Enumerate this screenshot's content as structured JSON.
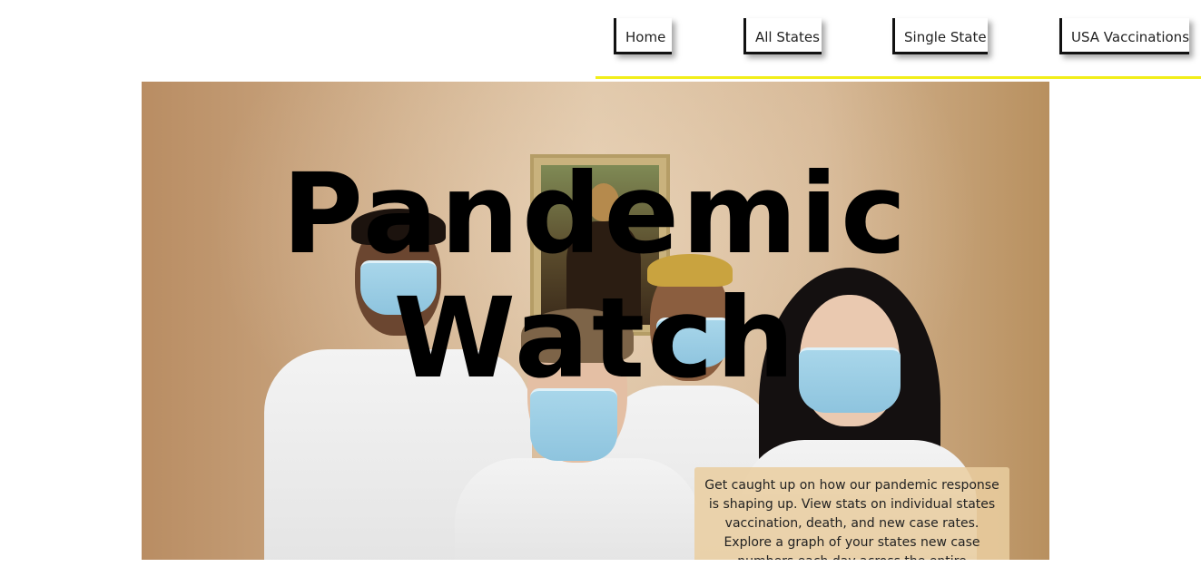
{
  "nav": {
    "items": [
      {
        "label": "Home"
      },
      {
        "label": "All States"
      },
      {
        "label": "Single State"
      },
      {
        "label": "USA Vaccinations"
      }
    ],
    "underline_color": "#f2ee1a"
  },
  "hero": {
    "title_line1": "Pandemic",
    "title_line2": "Watch",
    "description": "Get caught up on how our pandemic response is shaping up. View stats on individual states vaccination, death, and new case rates. Explore a graph of your states new case numbers each day across the entire",
    "image_subject": "group of people wearing surgical face masks in front of a masked Mona Lisa painting"
  }
}
